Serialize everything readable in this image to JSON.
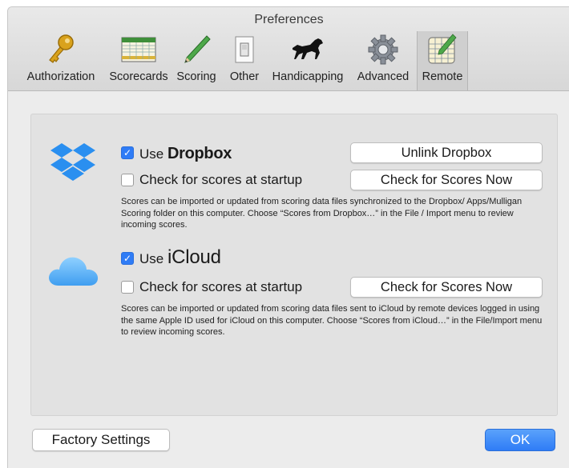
{
  "window": {
    "title": "Preferences"
  },
  "toolbar": {
    "tabs": [
      {
        "label": "Authorization",
        "icon": "key-icon"
      },
      {
        "label": "Scorecards",
        "icon": "scorecard-icon"
      },
      {
        "label": "Scoring",
        "icon": "pencil-icon"
      },
      {
        "label": "Other",
        "icon": "switch-icon"
      },
      {
        "label": "Handicapping",
        "icon": "horse-icon"
      },
      {
        "label": "Advanced",
        "icon": "gear-icon"
      },
      {
        "label": "Remote",
        "icon": "scorecard-pencil-icon",
        "selected": true
      }
    ]
  },
  "dropbox": {
    "use_prefix": "Use",
    "brand": "Dropbox",
    "use_checked": true,
    "startup_label": "Check for scores at startup",
    "startup_checked": false,
    "unlink_button": "Unlink Dropbox",
    "check_button": "Check for Scores Now",
    "description": "Scores can be imported or updated from scoring data files synchronized to the Dropbox/ Apps/Mulligan Scoring folder on this computer.  Choose “Scores from Dropbox…” in the File / Import menu to review incoming scores."
  },
  "icloud": {
    "use_prefix": "Use",
    "brand": "iCloud",
    "use_checked": true,
    "startup_label": "Check for scores at startup",
    "startup_checked": false,
    "check_button": "Check for Scores Now",
    "description": "Scores can be imported or updated from scoring data files sent to iCloud by remote devices logged in using the same Apple ID used for iCloud on this computer.  Choose “Scores from iCloud…” in the File/Import menu to review incoming scores."
  },
  "footer": {
    "factory_button": "Factory Settings",
    "ok_button": "OK"
  },
  "colors": {
    "accent": "#2f7cf6",
    "dropbox": "#2a8ff0",
    "icloud": "#5ab0f5"
  }
}
